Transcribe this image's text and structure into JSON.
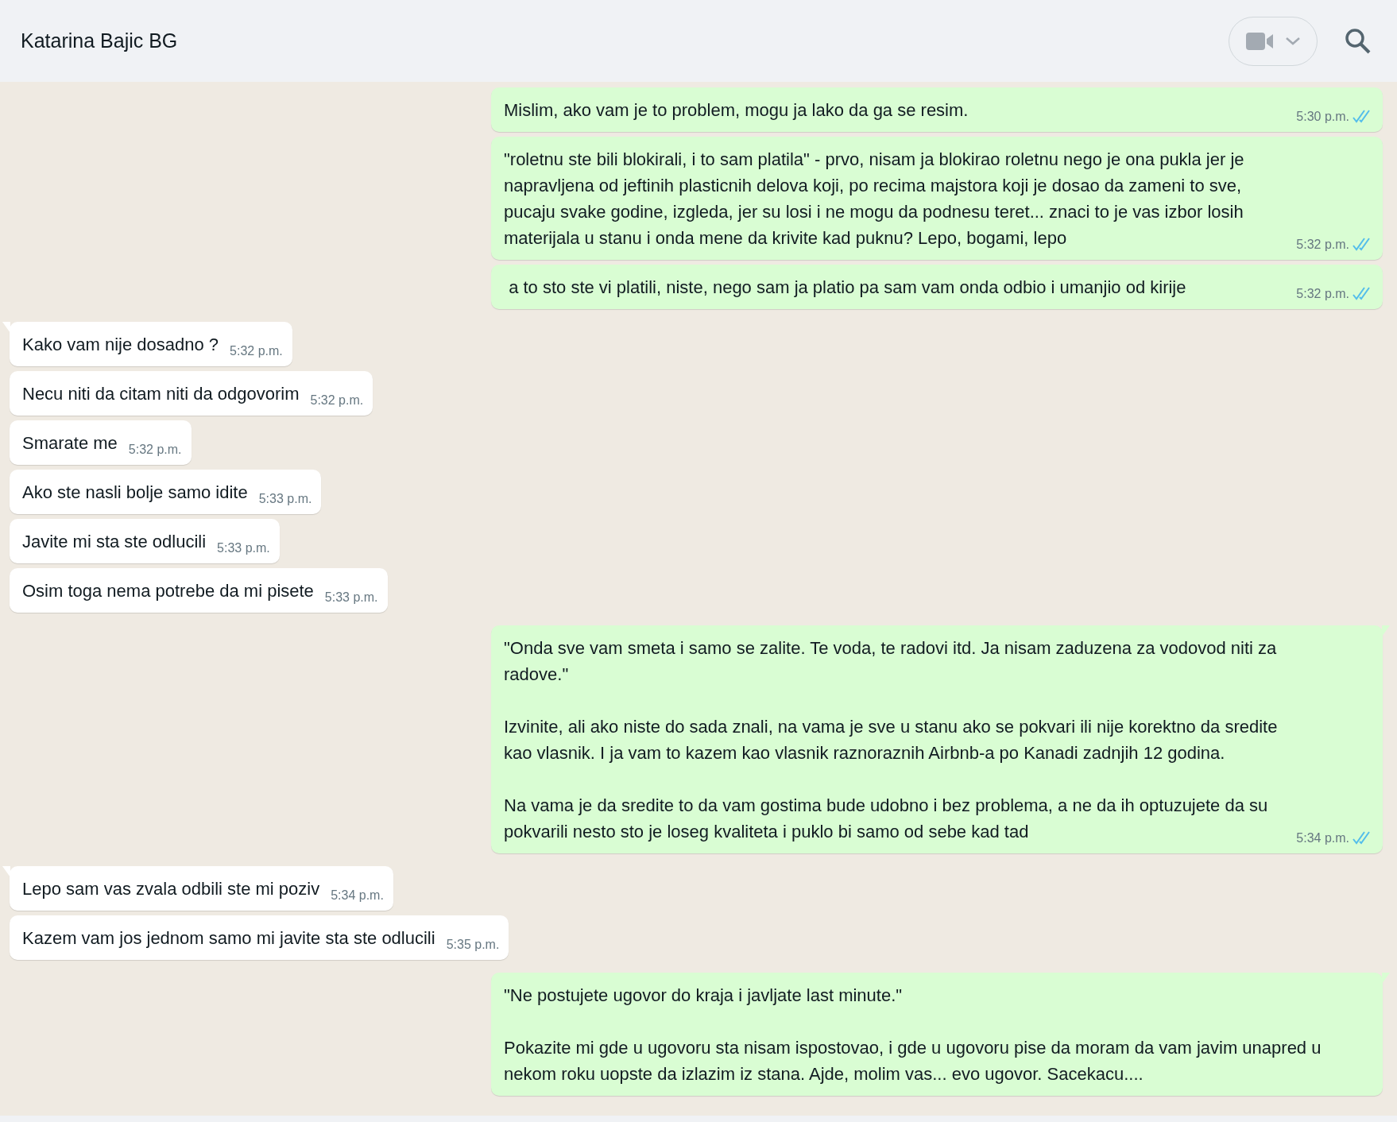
{
  "chat": {
    "title": "Katarina Bajic BG"
  },
  "messages": [
    {
      "kind": "out",
      "tail": false,
      "paragraphs": [
        "Mislim, ako vam je to problem, mogu ja lako da ga se resim."
      ],
      "time": "5:30 p.m.",
      "read": true
    },
    {
      "kind": "out",
      "tail": false,
      "paragraphs": [
        "\"roletnu ste bili blokirali, i to sam platila\" - prvo, nisam ja blokirao roletnu nego je ona pukla jer je napravljena od jeftinih plasticnih delova koji, po recima majstora koji je dosao da zameni to sve, pucaju svake godine, izgleda, jer su losi i ne mogu da podnesu teret... znaci to je vas izbor losih materijala u stanu i onda mene da krivite kad puknu? Lepo, bogami, lepo"
      ],
      "time": "5:32 p.m.",
      "read": true
    },
    {
      "kind": "out",
      "tail": false,
      "paragraphs": [
        " a to sto ste vi platili, niste, nego sam ja platio pa sam vam onda odbio i umanjio od kirije"
      ],
      "time": "5:32 p.m.",
      "read": true
    },
    {
      "kind": "in",
      "tail": true,
      "paragraphs": [
        "Kako vam nije dosadno ?"
      ],
      "time": "5:32 p.m."
    },
    {
      "kind": "in",
      "tail": false,
      "paragraphs": [
        "Necu niti da citam niti da odgovorim"
      ],
      "time": "5:32 p.m."
    },
    {
      "kind": "in",
      "tail": false,
      "paragraphs": [
        "Smarate me"
      ],
      "time": "5:32 p.m."
    },
    {
      "kind": "in",
      "tail": false,
      "paragraphs": [
        "Ako ste nasli bolje samo idite"
      ],
      "time": "5:33 p.m."
    },
    {
      "kind": "in",
      "tail": false,
      "paragraphs": [
        "Javite mi sta ste odlucili"
      ],
      "time": "5:33 p.m."
    },
    {
      "kind": "in",
      "tail": false,
      "paragraphs": [
        "Osim toga nema potrebe da mi pisete"
      ],
      "time": "5:33 p.m."
    },
    {
      "kind": "out",
      "tail": true,
      "paragraphs": [
        "\"Onda sve vam smeta i samo se zalite. Te voda, te radovi itd. Ja nisam zaduzena za vodovod niti za radove.\"",
        "Izvinite, ali ako niste do sada znali, na vama je sve u stanu ako se pokvari ili nije korektno da sredite kao vlasnik. I ja vam to kazem kao vlasnik raznoraznih Airbnb-a po Kanadi zadnjih 12 godina.",
        "Na vama je da sredite to da vam gostima bude udobno i bez problema, a ne da ih optuzujete da su pokvarili nesto sto je loseg kvaliteta i puklo bi samo od sebe kad tad"
      ],
      "time": "5:34 p.m.",
      "read": true
    },
    {
      "kind": "in",
      "tail": true,
      "paragraphs": [
        "Lepo sam vas zvala odbili ste mi poziv"
      ],
      "time": "5:34 p.m."
    },
    {
      "kind": "in",
      "tail": false,
      "paragraphs": [
        "Kazem vam jos jednom samo mi javite sta ste odlucili"
      ],
      "time": "5:35 p.m."
    },
    {
      "kind": "out",
      "tail": true,
      "paragraphs": [
        "\"Ne postujete ugovor do kraja i javljate last minute.\"",
        "Pokazite mi gde u ugovoru sta nisam ispostovao, i gde u ugovoru pise da moram da vam javim unapred u nekom roku uopste da izlazim iz stana. Ajde, molim vas... evo ugovor. Sacekacu...."
      ]
    }
  ]
}
